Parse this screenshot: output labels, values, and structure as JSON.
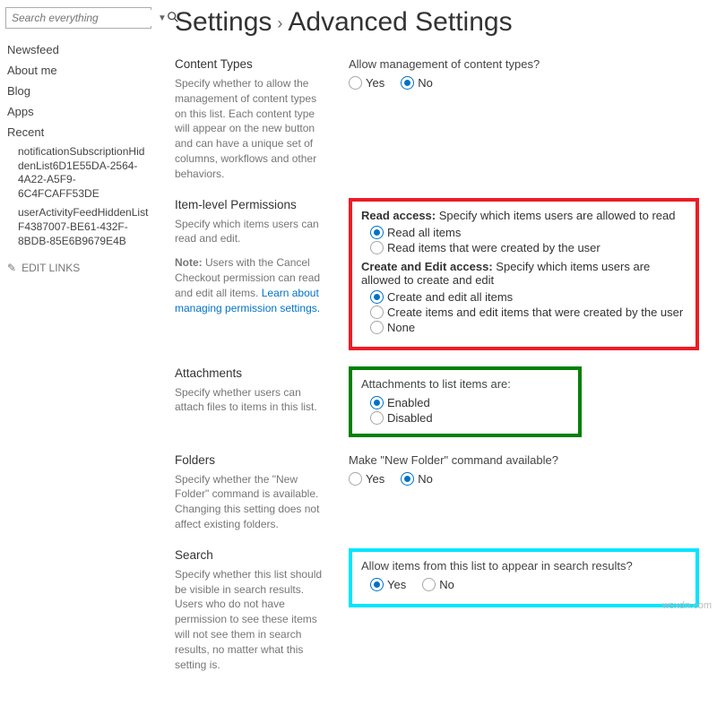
{
  "search": {
    "placeholder": "Search everything"
  },
  "nav": {
    "newsfeed": "Newsfeed",
    "aboutme": "About me",
    "blog": "Blog",
    "apps": "Apps",
    "recent_label": "Recent",
    "recent1": "notificationSubscriptionHiddenList6D1E55DA-2564-4A22-A5F9-6C4FCAFF53DE",
    "recent2": "userActivityFeedHiddenListF4387007-BE61-432F-8BDB-85E6B9679E4B",
    "edit_links": "EDIT LINKS"
  },
  "title": {
    "a": "Settings",
    "b": "Advanced Settings"
  },
  "contentTypes": {
    "heading": "Content Types",
    "desc": "Specify whether to allow the management of content types on this list. Each content type will appear on the new button and can have a unique set of columns, workflows and other behaviors.",
    "question": "Allow management of content types?",
    "yes": "Yes",
    "no": "No"
  },
  "perms": {
    "heading": "Item-level Permissions",
    "desc": "Specify which items users can read and edit.",
    "note_label": "Note:",
    "note_text": " Users with the Cancel Checkout permission can read and edit all items. ",
    "note_link": "Learn about managing permission settings.",
    "read_label": "Read access:",
    "read_desc": "  Specify which items users are allowed to read",
    "read1": "Read all items",
    "read2": "Read items that were created by the user",
    "edit_label": "Create and Edit access:",
    "edit_desc": "  Specify which items users are allowed to create and edit",
    "edit1": "Create and edit all items",
    "edit2": "Create items and edit items that were created by the user",
    "edit3": "None"
  },
  "attach": {
    "heading": "Attachments",
    "desc": "Specify whether users can attach files to items in this list.",
    "question": "Attachments to list items are:",
    "enabled": "Enabled",
    "disabled": "Disabled"
  },
  "folders": {
    "heading": "Folders",
    "desc": "Specify whether the \"New Folder\" command is available. Changing this setting does not affect existing folders.",
    "question": "Make \"New Folder\" command available?",
    "yes": "Yes",
    "no": "No"
  },
  "searchSec": {
    "heading": "Search",
    "desc": "Specify whether this list should be visible in search results. Users who do not have permission to see these items will not see them in search results, no matter what this setting is.",
    "question": "Allow items from this list to appear in search results?",
    "yes": "Yes",
    "no": "No"
  },
  "watermark": "wsxdn.com"
}
